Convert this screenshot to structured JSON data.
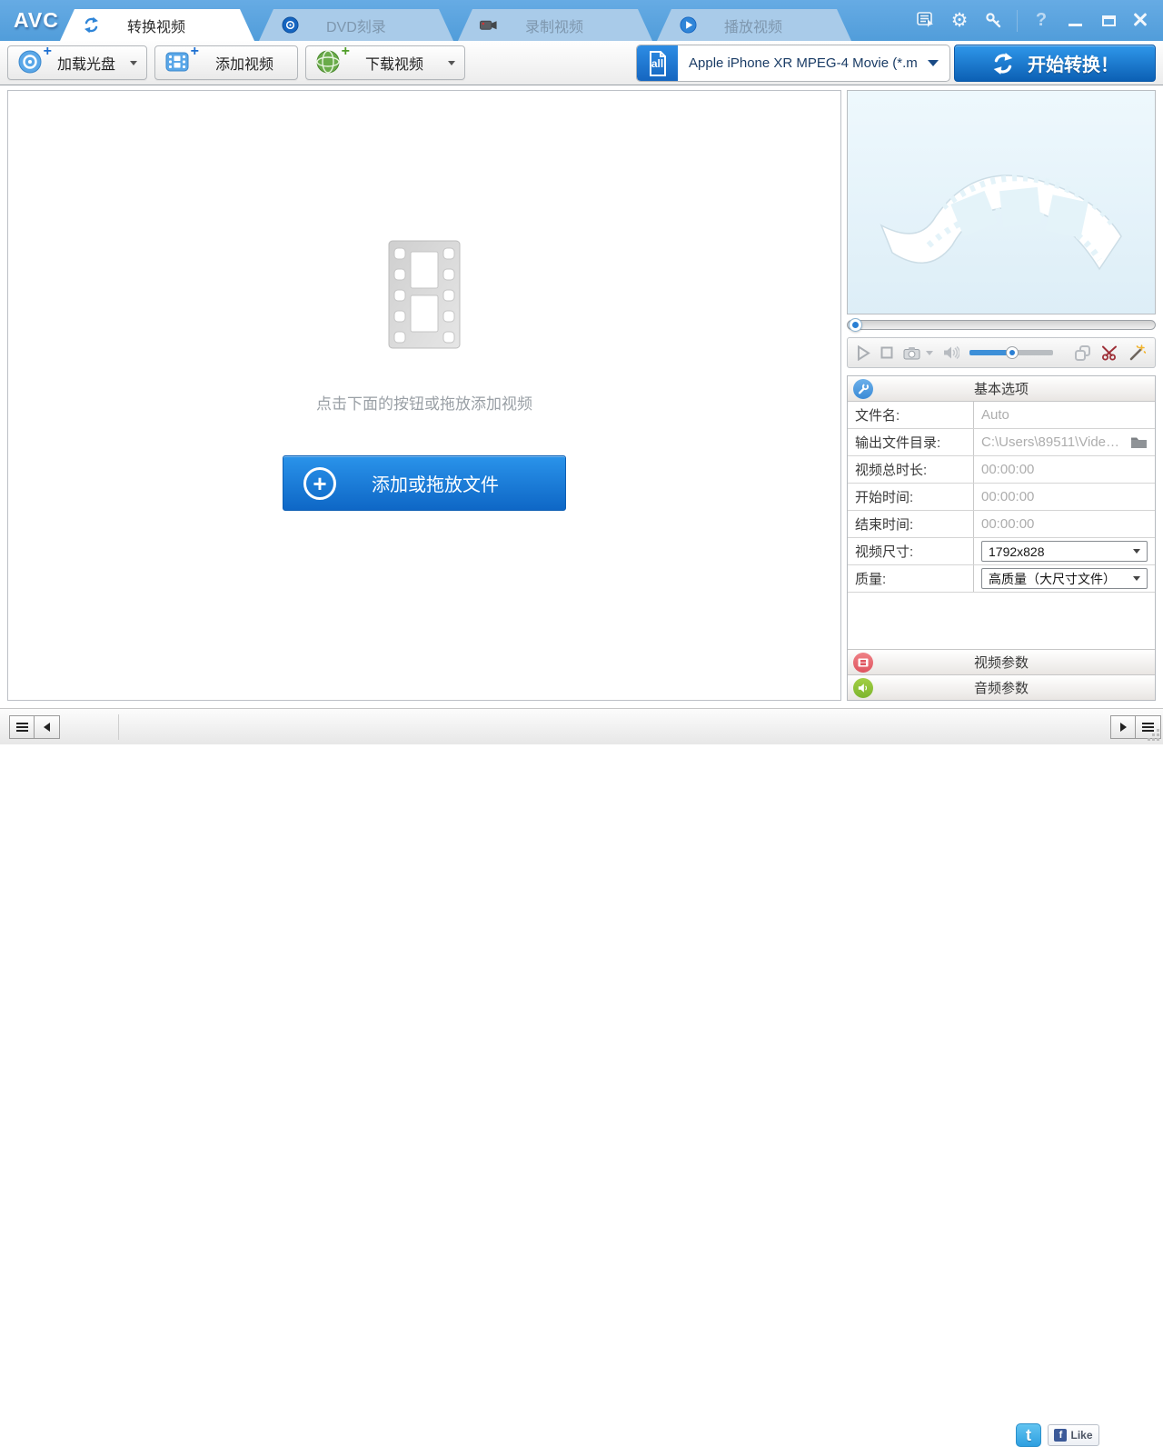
{
  "titlebar": {
    "logo": "AVC",
    "tabs": [
      {
        "label": "转换视频",
        "icon": "sync-icon",
        "active": true
      },
      {
        "label": "DVD刻录",
        "icon": "disc-icon",
        "active": false
      },
      {
        "label": "录制视频",
        "icon": "camera-icon",
        "active": false
      },
      {
        "label": "播放视频",
        "icon": "play-circle-icon",
        "active": false
      }
    ],
    "help_label": "?",
    "window_icons": [
      "log-panel-icon",
      "settings-gear-icon",
      "register-key-icon",
      "help-icon",
      "minimize-icon",
      "maximize-icon",
      "close-icon"
    ]
  },
  "toolbar": {
    "load_disc_label": "加载光盘",
    "add_video_label": "添加视频",
    "download_video_label": "下载视频",
    "format_icon_label": "all",
    "format_selected": "Apple iPhone XR MPEG-4 Movie (*.m...",
    "start_convert_label": "开始转换！"
  },
  "main": {
    "drop_hint": "点击下面的按钮或拖放添加视频",
    "add_files_label": "添加或拖放文件"
  },
  "preview_controls": {
    "icons": [
      "play-icon",
      "stop-icon",
      "snapshot-camera-icon",
      "snapshot-dropdown-arrow",
      "speaker-icon",
      "volume-slider",
      "clip-pages-icon",
      "scissors-icon",
      "magic-wand-icon"
    ]
  },
  "options": {
    "title": "基本选项",
    "rows": [
      {
        "label": "文件名:",
        "value": "Auto",
        "control": "text"
      },
      {
        "label": "输出文件目录:",
        "value": "C:\\Users\\89511\\Videos\\...",
        "control": "path"
      },
      {
        "label": "视频总时长:",
        "value": "00:00:00",
        "control": "text"
      },
      {
        "label": "开始时间:",
        "value": "00:00:00",
        "control": "text"
      },
      {
        "label": "结束时间:",
        "value": "00:00:00",
        "control": "text"
      },
      {
        "label": "视频尺寸:",
        "value": "1792x828",
        "control": "dropdown"
      },
      {
        "label": "质量:",
        "value": "高质量（大尺寸文件）",
        "control": "dropdown"
      }
    ]
  },
  "panels": {
    "video_params_label": "视频参数",
    "audio_params_label": "音频参数"
  },
  "statusbar": {
    "twitter_logo": "t",
    "facebook_like_label": "Like"
  },
  "colors": {
    "titlebar_blue": "#58a0dc",
    "inactive_tab_blue": "#a9cbe9",
    "accent_blue": "#0e67c6",
    "preview_bg": "#e4f3f9",
    "muted_text": "#adadad",
    "section_red": "#df5560",
    "section_green": "#7cb52d"
  }
}
